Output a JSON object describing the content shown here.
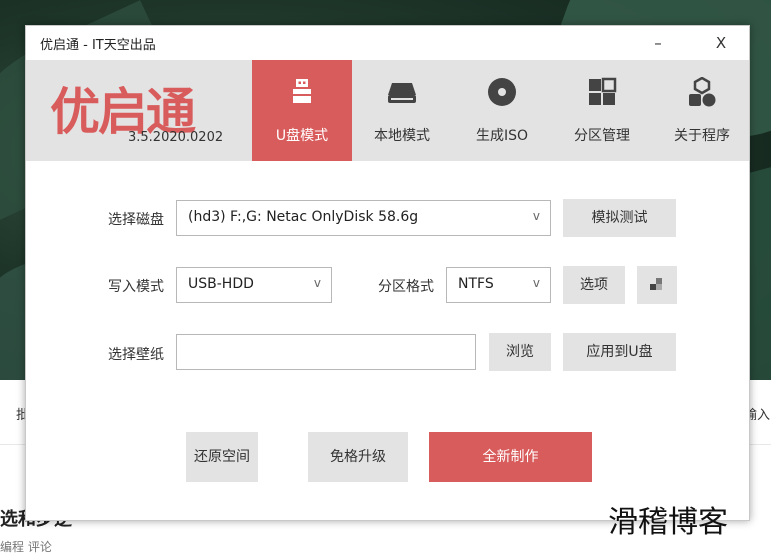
{
  "background": {
    "left_text": "批",
    "right_text": "输入",
    "heading": "选和步逆",
    "sub": "编程 评论"
  },
  "window": {
    "title": "优启通 - IT天空出品",
    "minimize": "–",
    "close": "X"
  },
  "header": {
    "logo": "优启通",
    "version": "3.5.2020.0202",
    "nav": [
      {
        "label": "U盘模式",
        "icon": "usb-drive-icon",
        "active": true
      },
      {
        "label": "本地模式",
        "icon": "hard-disk-icon",
        "active": false
      },
      {
        "label": "生成ISO",
        "icon": "disc-icon",
        "active": false
      },
      {
        "label": "分区管理",
        "icon": "partition-grid-icon",
        "active": false
      },
      {
        "label": "关于程序",
        "icon": "about-shapes-icon",
        "active": false
      }
    ]
  },
  "form": {
    "disk_label": "选择磁盘",
    "disk_value": "(hd3) F:,G: Netac OnlyDisk 58.6g",
    "simulate_button": "模拟测试",
    "write_mode_label": "写入模式",
    "write_mode_value": "USB-HDD",
    "partition_format_label": "分区格式",
    "partition_format_value": "NTFS",
    "options_button": "选项",
    "wallpaper_label": "选择壁纸",
    "wallpaper_value": "",
    "browse_button": "浏览",
    "apply_to_usb_button": "应用到U盘"
  },
  "actions": {
    "restore_space": "还原空间",
    "upgrade_no_format": "免格升级",
    "new_create": "全新制作"
  },
  "colors": {
    "accent": "#d95c5c",
    "header_bg": "#e3e3e3",
    "button_bg": "#e3e3e3"
  },
  "watermark": "滑稽博客"
}
